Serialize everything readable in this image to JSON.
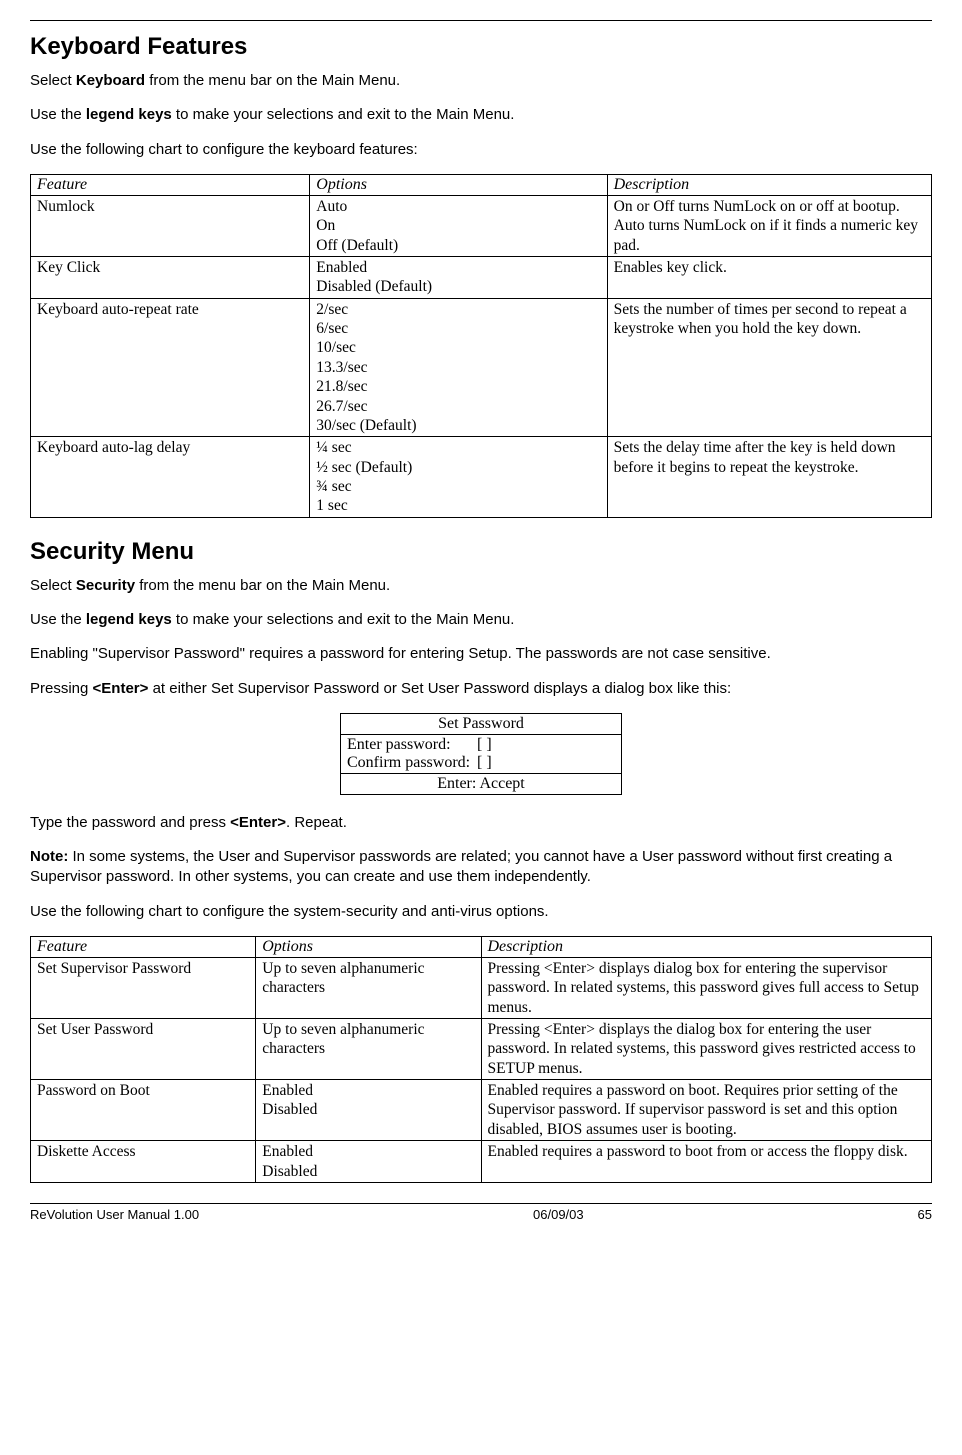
{
  "section1": {
    "title": "Keyboard Features",
    "p1a": "Select ",
    "p1b": "Keyboard",
    "p1c": " from the menu bar on the Main Menu.",
    "p2a": "Use the ",
    "p2b": "legend keys",
    "p2c": " to make your selections and exit to the Main Menu.",
    "p3": "Use the following chart to configure the keyboard features:"
  },
  "table1": {
    "headers": {
      "c1": "Feature",
      "c2": "Options",
      "c3": "Description"
    },
    "rows": [
      {
        "feature": "Numlock",
        "options": [
          "Auto",
          "On",
          "Off (Default)"
        ],
        "desc": "On or Off turns NumLock on or off at bootup. Auto turns NumLock on if it finds a numeric key pad."
      },
      {
        "feature": "Key Click",
        "options": [
          "Enabled",
          "Disabled (Default)"
        ],
        "desc": "Enables key click."
      },
      {
        "feature": "Keyboard auto-repeat rate",
        "options": [
          "2/sec",
          "6/sec",
          "10/sec",
          "13.3/sec",
          "21.8/sec",
          "26.7/sec",
          "30/sec (Default)"
        ],
        "desc": "Sets the number of times per second to repeat a keystroke when you hold the key down."
      },
      {
        "feature": "Keyboard auto-lag delay",
        "options": [
          "¼ sec",
          "½ sec (Default)",
          "¾ sec",
          "1 sec"
        ],
        "desc": "Sets the delay time after the key is held down before it begins to repeat the keystroke."
      }
    ]
  },
  "section2": {
    "title": "Security Menu",
    "p1a": "Select ",
    "p1b": "Security",
    "p1c": " from the menu bar on the Main Menu.",
    "p2a": "Use the ",
    "p2b": "legend keys",
    "p2c": " to make your selections and exit to the Main Menu.",
    "p3": "Enabling \"Supervisor Password\" requires a password for entering Setup. The passwords are not case sensitive.",
    "p4a": "Pressing ",
    "p4b": "<Enter>",
    "p4c": " at either Set Supervisor Password or Set User Password displays a dialog box like this:"
  },
  "dialog": {
    "title": "Set Password",
    "row1_label": "Enter password:",
    "row1_field": "[                    ]",
    "row2_label": "Confirm password:",
    "row2_field": "[                    ]",
    "footer": "Enter: Accept"
  },
  "section3": {
    "p1a": "Type the password and press ",
    "p1b": "<Enter>",
    "p1c": ". Repeat.",
    "noteLabel": "Note:",
    "noteText": " In some systems, the User and Supervisor passwords are related; you cannot have a User password without first creating a Supervisor password. In other systems, you can create and use them independently.",
    "p3": "Use the following chart to configure the system-security and anti-virus options."
  },
  "table2": {
    "headers": {
      "c1": "Feature",
      "c2": "Options",
      "c3": "Description"
    },
    "rows": [
      {
        "feature": "Set Supervisor Password",
        "options": [
          "Up to seven alphanumeric characters"
        ],
        "desc": "Pressing <Enter> displays dialog box for entering the supervisor password. In related systems, this password gives full access to Setup menus."
      },
      {
        "feature": "Set User Password",
        "options": [
          "Up to seven alphanumeric characters"
        ],
        "desc": "Pressing <Enter> displays the dialog box for entering the user password. In related systems, this password gives restricted access to SETUP menus."
      },
      {
        "feature": "Password on Boot",
        "options": [
          "Enabled",
          "Disabled"
        ],
        "desc": "Enabled requires a password on boot. Requires prior setting of the Supervisor password. If supervisor password is set and this option disabled, BIOS assumes user is booting."
      },
      {
        "feature": "Diskette Access",
        "options": [
          "Enabled",
          "Disabled"
        ],
        "desc": "Enabled requires a password to boot from or access the floppy disk."
      }
    ]
  },
  "footer": {
    "left": "ReVolution User Manual 1.00",
    "center": "06/09/03",
    "right": "65"
  }
}
